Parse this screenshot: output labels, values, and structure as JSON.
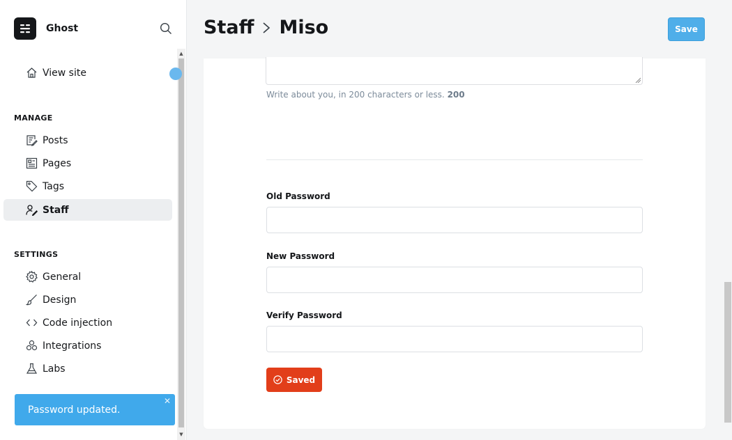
{
  "brand": {
    "name": "Ghost"
  },
  "sidebar": {
    "view_site": "View site",
    "manage_label": "MANAGE",
    "manage_items": [
      {
        "label": "Posts",
        "icon": "posts-icon"
      },
      {
        "label": "Pages",
        "icon": "pages-icon"
      },
      {
        "label": "Tags",
        "icon": "tag-icon"
      },
      {
        "label": "Staff",
        "icon": "staff-icon",
        "active": true
      }
    ],
    "settings_label": "SETTINGS",
    "settings_items": [
      {
        "label": "General",
        "icon": "gear-icon"
      },
      {
        "label": "Design",
        "icon": "brush-icon"
      },
      {
        "label": "Code injection",
        "icon": "code-icon"
      },
      {
        "label": "Integrations",
        "icon": "integrations-icon"
      },
      {
        "label": "Labs",
        "icon": "flask-icon"
      }
    ]
  },
  "toast": {
    "message": "Password updated."
  },
  "header": {
    "breadcrumb_root": "Staff",
    "breadcrumb_current": "Miso",
    "save_label": "Save"
  },
  "form": {
    "bio_help": "Write about you, in 200 characters or less.",
    "bio_count": "200",
    "old_password_label": "Old Password",
    "old_password_value": "",
    "new_password_label": "New Password",
    "new_password_value": "",
    "verify_password_label": "Verify Password",
    "verify_password_value": "",
    "change_button_label": "Saved"
  },
  "colors": {
    "accent": "#40a9eb",
    "danger": "#e23e1a",
    "text": "#15171a"
  }
}
